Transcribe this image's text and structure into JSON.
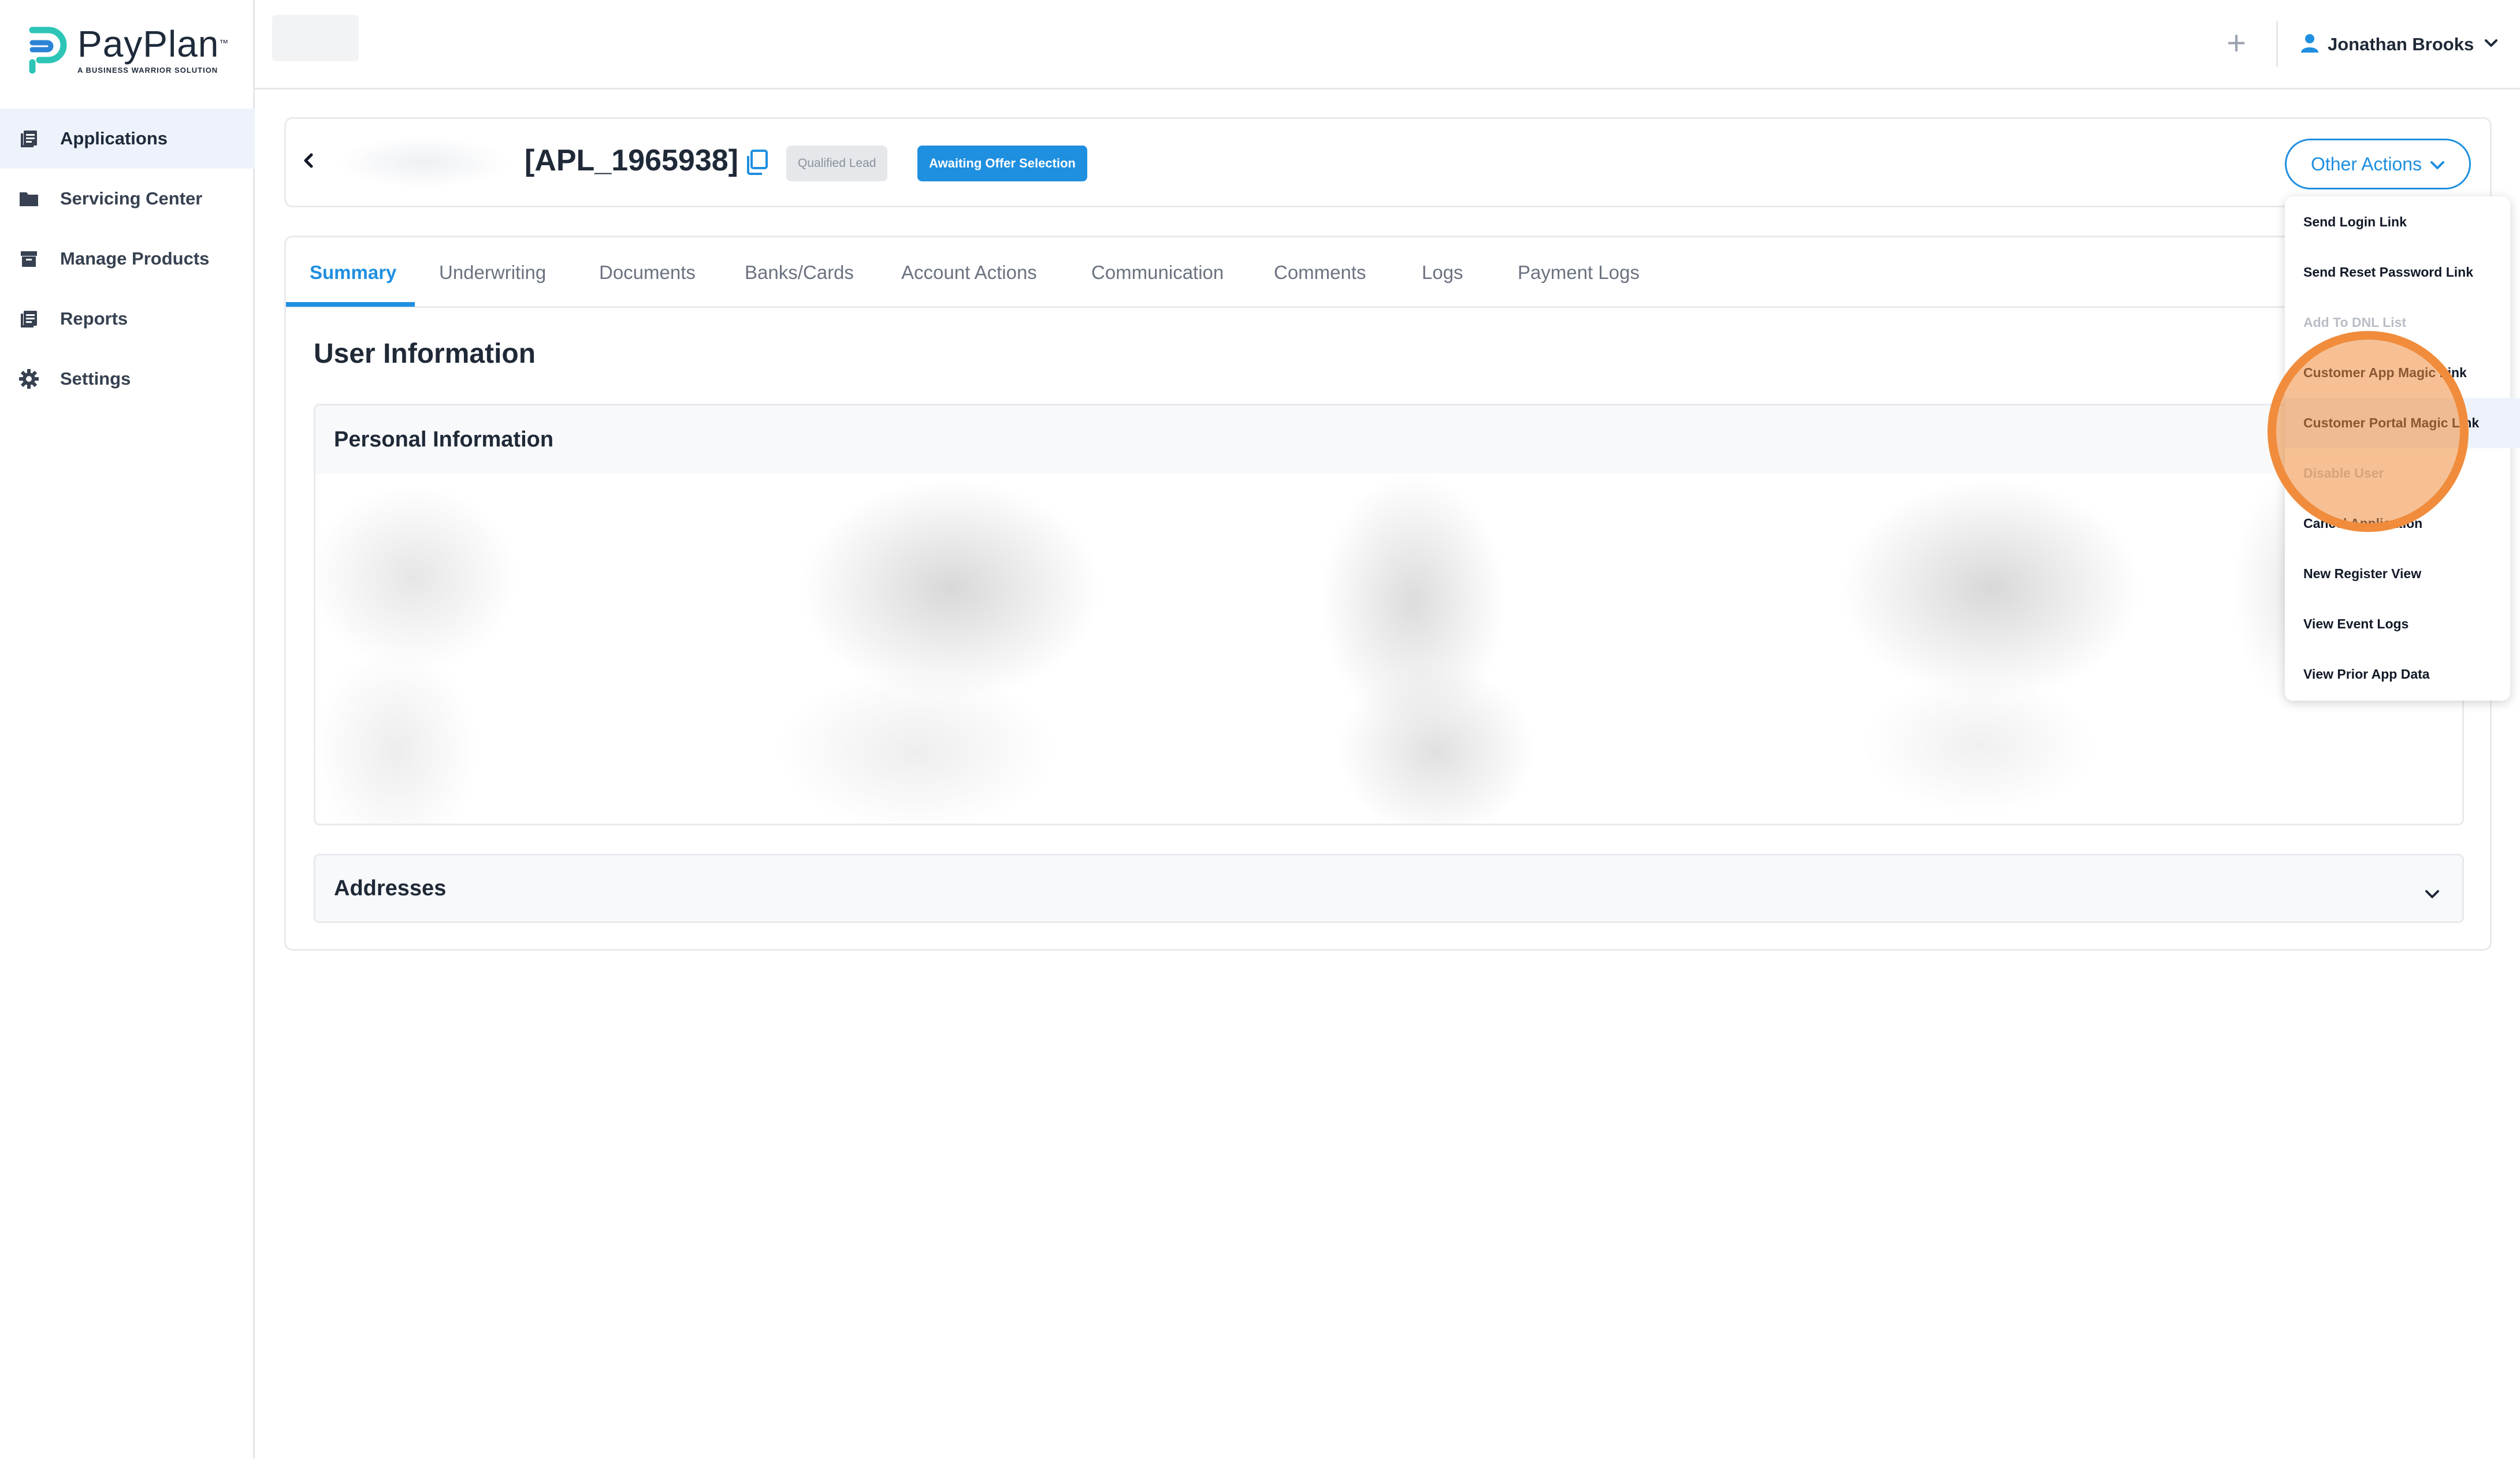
{
  "brand": {
    "name": "PayPlan",
    "trademark": "™",
    "tagline": "A BUSINESS WARRIOR SOLUTION",
    "accent": "#1f8fe0",
    "logo_color": "#2cc5b6"
  },
  "sidebar": {
    "items": [
      {
        "label": "Applications",
        "icon": "applications-icon",
        "active": true
      },
      {
        "label": "Servicing Center",
        "icon": "folder-icon",
        "active": false
      },
      {
        "label": "Manage Products",
        "icon": "archive-box-icon",
        "active": false
      },
      {
        "label": "Reports",
        "icon": "reports-icon",
        "active": false
      },
      {
        "label": "Settings",
        "icon": "gear-icon",
        "active": false
      }
    ],
    "collapse_glyph": "‹"
  },
  "topbar": {
    "plus_glyph": "+",
    "user_name": "Jonathan Brooks"
  },
  "application": {
    "id": "[APL_1965938]",
    "badges": {
      "lead": "Qualified Lead",
      "status": "Awaiting Offer Selection"
    },
    "other_actions_label": "Other Actions"
  },
  "tabs": [
    "Summary",
    "Underwriting",
    "Documents",
    "Banks/Cards",
    "Account Actions",
    "Communication",
    "Comments",
    "Logs",
    "Payment Logs"
  ],
  "summary": {
    "section_title": "User Information",
    "personal_info_title": "Personal Information",
    "addresses_title": "Addresses"
  },
  "dropdown": {
    "items": [
      {
        "label": "Send Login Link",
        "disabled": false
      },
      {
        "label": "Send Reset Password Link",
        "disabled": false
      },
      {
        "label": "Add To DNL List",
        "disabled": true
      },
      {
        "label": "Customer App Magic Link",
        "disabled": false
      },
      {
        "label": "Customer Portal Magic Link",
        "disabled": false
      },
      {
        "label": "Disable User",
        "disabled": true
      },
      {
        "label": "Cancel Application",
        "disabled": false
      },
      {
        "label": "New Register View",
        "disabled": false
      },
      {
        "label": "View Event Logs",
        "disabled": false
      },
      {
        "label": "View Prior App Data",
        "disabled": false
      }
    ]
  }
}
